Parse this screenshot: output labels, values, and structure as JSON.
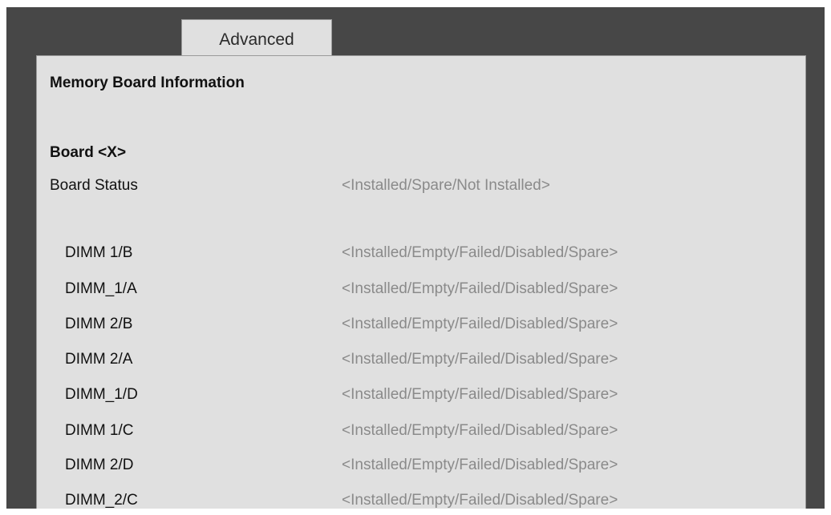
{
  "tab": {
    "label": "Advanced"
  },
  "section": {
    "title": "Memory Board Information",
    "board_label": "Board <X>"
  },
  "board_status": {
    "label": "Board Status",
    "value": "<Installed/Spare/Not Installed>"
  },
  "dimms": [
    {
      "label": "DIMM  1/B",
      "value": "<Installed/Empty/Failed/Disabled/Spare>"
    },
    {
      "label": "DIMM_1/A",
      "value": "<Installed/Empty/Failed/Disabled/Spare>"
    },
    {
      "label": "DIMM  2/B",
      "value": "<Installed/Empty/Failed/Disabled/Spare>"
    },
    {
      "label": "DIMM  2/A",
      "value": "<Installed/Empty/Failed/Disabled/Spare>"
    },
    {
      "label": "DIMM_1/D",
      "value": "<Installed/Empty/Failed/Disabled/Spare>"
    },
    {
      "label": "DIMM  1/C",
      "value": "<Installed/Empty/Failed/Disabled/Spare>"
    },
    {
      "label": "DIMM  2/D",
      "value": "<Installed/Empty/Failed/Disabled/Spare>"
    },
    {
      "label": "DIMM_2/C",
      "value": "<Installed/Empty/Failed/Disabled/Spare>"
    }
  ]
}
